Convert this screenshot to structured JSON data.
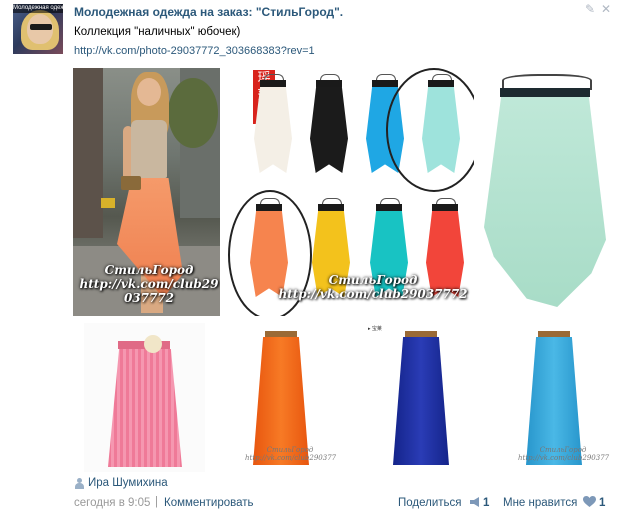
{
  "post": {
    "group_title": "Молодежная одежда на заказ: \"СтильГород\".",
    "avatar_text": "Молодежная одежда",
    "description": "Коллекция \"наличных\" юбочек)",
    "link": "http://vk.com/photo-29037772_303668383?rev=1",
    "edit_icon": "pencil-icon",
    "close_icon": "close-icon"
  },
  "photos": {
    "p1_watermark_line1": "СтильГород",
    "p1_watermark_line2": "http://vk.com/club29",
    "p1_watermark_line3": "037772",
    "p2_stamp": "瑶萍安",
    "p2_watermark_line1": "СтильГород",
    "p2_watermark_line2": "http://vk.com/club29037772",
    "p5_watermark_line1": "СтильГород",
    "p5_watermark_line2": "http://vk.com/club29037772",
    "p6_label": "▸ 宝莱",
    "p7_watermark_line1": "СтильГород",
    "p7_watermark_line2": "http://vk.com/club29037772",
    "skirt_colors": [
      "#f4efe6",
      "#1b1b1b",
      "#1fa7e4",
      "#9ee3dc",
      "#f6844e",
      "#f3c21c",
      "#18c3c3",
      "#f2453a"
    ],
    "accent_colors": {
      "coral": "#ef7f4f",
      "mint": "#a8dcc7",
      "pink": "#ef7a98",
      "orange": "#f36a1a",
      "navy": "#1e2f9e",
      "sky": "#38a9dc"
    }
  },
  "footer": {
    "author": "Ира Шумихина",
    "date": "сегодня в 9:05",
    "separator": "|",
    "comment": "Комментировать",
    "share": "Поделиться",
    "share_count": "1",
    "like": "Мне нравится",
    "like_count": "1"
  }
}
